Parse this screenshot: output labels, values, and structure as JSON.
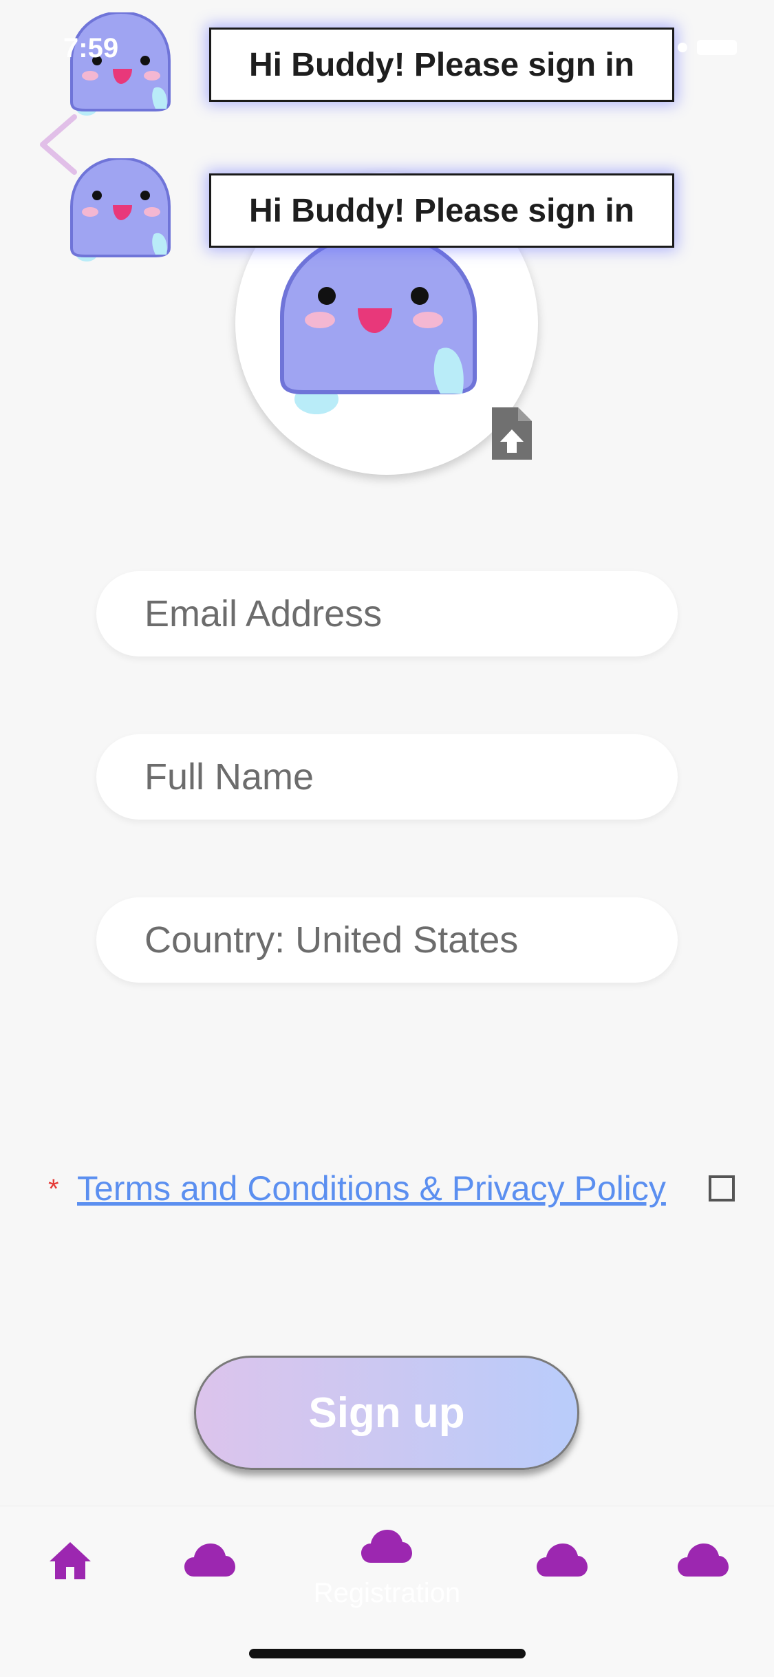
{
  "status_bar": {
    "time": "7:59"
  },
  "toasts": [
    {
      "message": "Hi Buddy! Please sign in"
    },
    {
      "message": "Hi Buddy! Please sign in"
    }
  ],
  "form": {
    "email_placeholder": "Email Address",
    "fullname_placeholder": "Full Name",
    "country_value": "Country: United States"
  },
  "terms": {
    "required_marker": "*",
    "link_label": "Terms and Conditions & Privacy Policy",
    "checked": false
  },
  "signup": {
    "label": "Sign up"
  },
  "bottom_nav": {
    "active_label": "Registration",
    "items": [
      "home-icon",
      "cloud-icon",
      "cloud-icon",
      "cloud-icon",
      "cloud-icon"
    ]
  },
  "colors": {
    "accent_purple": "#9c27b0",
    "link_blue": "#5b8ff0",
    "required_red": "#e53935",
    "mascot_purple": "#9fa4f2"
  }
}
